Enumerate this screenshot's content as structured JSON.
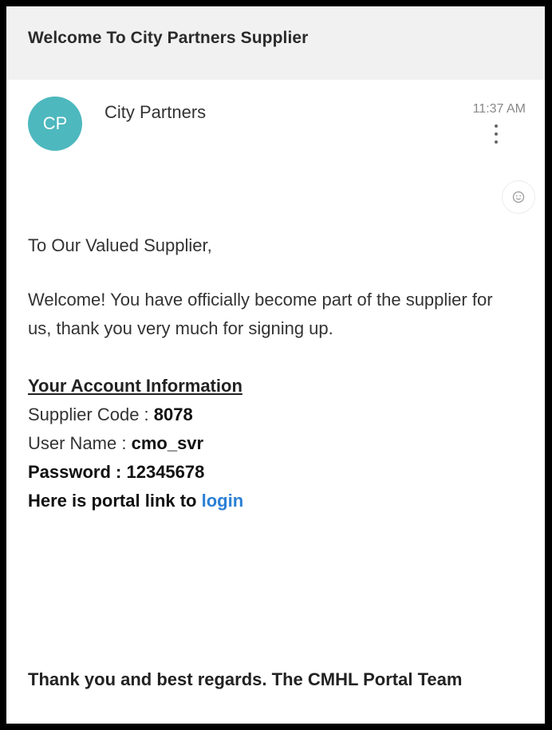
{
  "email": {
    "subject": "Welcome To City Partners Supplier",
    "sender": {
      "initials": "CP",
      "name": "City Partners",
      "avatar_color": "#4db8be"
    },
    "time": "11:37 AM",
    "icons": {
      "more": "more-vert-icon",
      "emoji": "smiley-icon"
    },
    "body": {
      "greeting": "To Our Valued Supplier,",
      "paragraph": "Welcome! You have officially become part of the supplier for us, thank you very much for signing up.",
      "account_heading": "Your Account Information",
      "supplier_code_label": "Supplier Code : ",
      "supplier_code_value": "8078",
      "user_name_label": "User Name : ",
      "user_name_value": "cmo_svr",
      "password_line": "Password : 12345678",
      "portal_text": "Here is portal link to ",
      "login_link": "login",
      "link_color": "#2b7fd4"
    },
    "signoff": "Thank you and best regards. The CMHL Portal Team"
  }
}
